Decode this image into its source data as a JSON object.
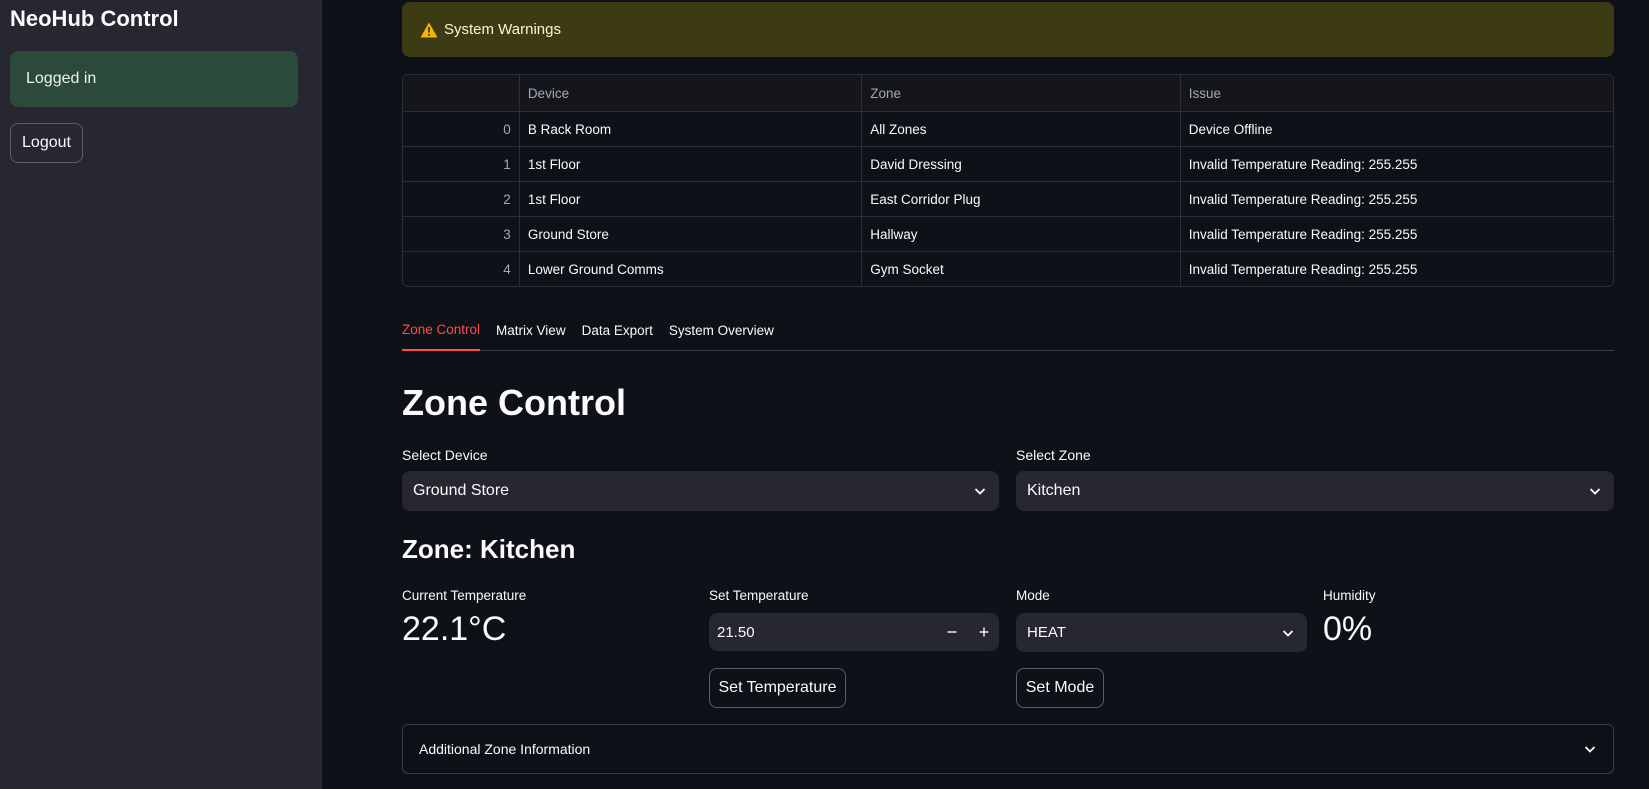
{
  "sidebar": {
    "app_title": "NeoHub Control",
    "login_status": "Logged in",
    "logout_label": "Logout"
  },
  "warning": {
    "text": "System Warnings"
  },
  "table": {
    "headers": [
      "",
      "Device",
      "Zone",
      "Issue"
    ],
    "rows": [
      {
        "index": "0",
        "device": "B Rack Room",
        "zone": "All Zones",
        "issue": "Device Offline"
      },
      {
        "index": "1",
        "device": "1st Floor",
        "zone": "David Dressing",
        "issue": "Invalid Temperature Reading: 255.255"
      },
      {
        "index": "2",
        "device": "1st Floor",
        "zone": "East Corridor Plug",
        "issue": "Invalid Temperature Reading: 255.255"
      },
      {
        "index": "3",
        "device": "Ground Store",
        "zone": "Hallway",
        "issue": "Invalid Temperature Reading: 255.255"
      },
      {
        "index": "4",
        "device": "Lower Ground Comms",
        "zone": "Gym Socket",
        "issue": "Invalid Temperature Reading: 255.255"
      }
    ]
  },
  "tabs": [
    {
      "label": "Zone Control",
      "active": true
    },
    {
      "label": "Matrix View",
      "active": false
    },
    {
      "label": "Data Export",
      "active": false
    },
    {
      "label": "System Overview",
      "active": false
    }
  ],
  "zone_control": {
    "title": "Zone Control",
    "device_label": "Select Device",
    "device_value": "Ground Store",
    "zone_label": "Select Zone",
    "zone_value": "Kitchen",
    "zone_heading": "Zone: Kitchen",
    "current_temp_label": "Current Temperature",
    "current_temp_value": "22.1°C",
    "set_temp_label": "Set Temperature",
    "set_temp_value": "21.50",
    "set_temp_button": "Set Temperature",
    "mode_label": "Mode",
    "mode_value": "HEAT",
    "set_mode_button": "Set Mode",
    "humidity_label": "Humidity",
    "humidity_value": "0%",
    "expander_label": "Additional Zone Information"
  },
  "colors": {
    "accent": "#ff4b4b",
    "background": "#0e1117",
    "sidebar": "#262730",
    "success_bg": "#2b4a3a",
    "warning_bg": "#3c3b13"
  },
  "icons": {
    "warning": "warning-triangle-icon",
    "chevron": "chevron-down-icon",
    "minus": "minus-icon",
    "plus": "plus-icon"
  }
}
